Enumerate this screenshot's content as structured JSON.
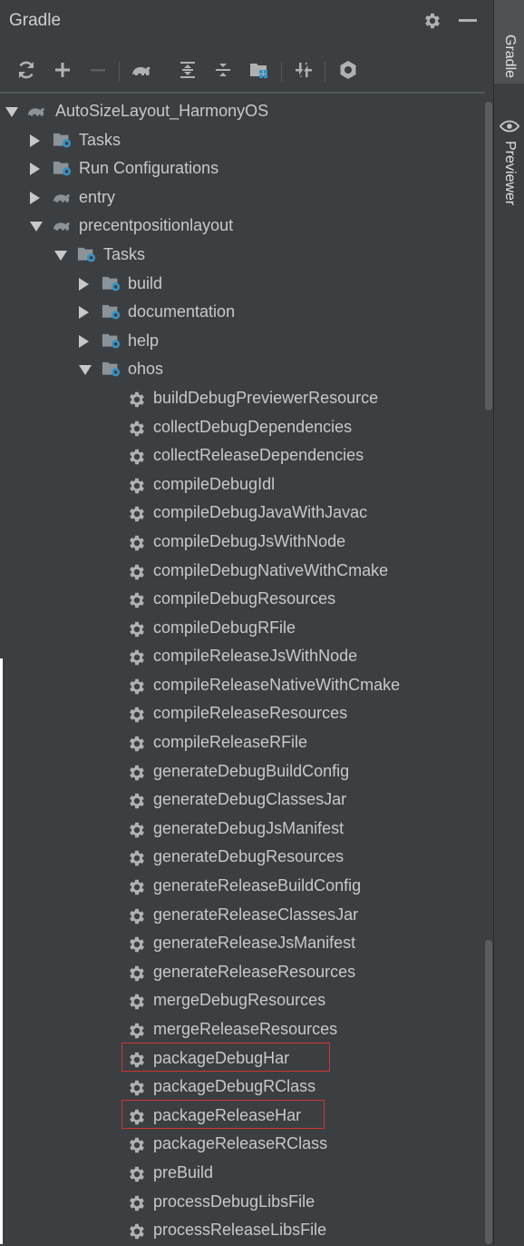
{
  "header": {
    "title": "Gradle"
  },
  "toolbar": {
    "buttons": [
      "refresh-icon",
      "add-icon",
      "remove-icon",
      "gradle-elephant-icon",
      "expand-all-icon",
      "collapse-all-icon",
      "group-modules-icon",
      "toggle-offline-icon",
      "settings-icon"
    ]
  },
  "side_tabs": {
    "gradle": "Gradle",
    "previewer": "Previewer"
  },
  "tree": {
    "root": "AutoSizeLayout_HarmonyOS",
    "root_children": [
      "Tasks",
      "Run Configurations",
      "entry"
    ],
    "module": "precentpositionlayout",
    "module_tasks": "Tasks",
    "task_groups": [
      "build",
      "documentation",
      "help",
      "ohos"
    ],
    "ohos_tasks": [
      "buildDebugPreviewerResource",
      "collectDebugDependencies",
      "collectReleaseDependencies",
      "compileDebugIdl",
      "compileDebugJavaWithJavac",
      "compileDebugJsWithNode",
      "compileDebugNativeWithCmake",
      "compileDebugResources",
      "compileDebugRFile",
      "compileReleaseJsWithNode",
      "compileReleaseNativeWithCmake",
      "compileReleaseResources",
      "compileReleaseRFile",
      "generateDebugBuildConfig",
      "generateDebugClassesJar",
      "generateDebugJsManifest",
      "generateDebugResources",
      "generateReleaseBuildConfig",
      "generateReleaseClassesJar",
      "generateReleaseJsManifest",
      "generateReleaseResources",
      "mergeDebugResources",
      "mergeReleaseResources",
      "packageDebugHar",
      "packageDebugRClass",
      "packageReleaseHar",
      "packageReleaseRClass",
      "preBuild",
      "processDebugLibsFile",
      "processReleaseLibsFile"
    ],
    "highlighted": [
      "packageDebugHar",
      "packageReleaseHar"
    ]
  },
  "colors": {
    "background": "#3c3f41",
    "text": "#c8c8c8",
    "highlight_border": "#d03434",
    "folder": "#8c9398",
    "gear": "#afb1b3",
    "accent_blue": "#3592c4"
  }
}
